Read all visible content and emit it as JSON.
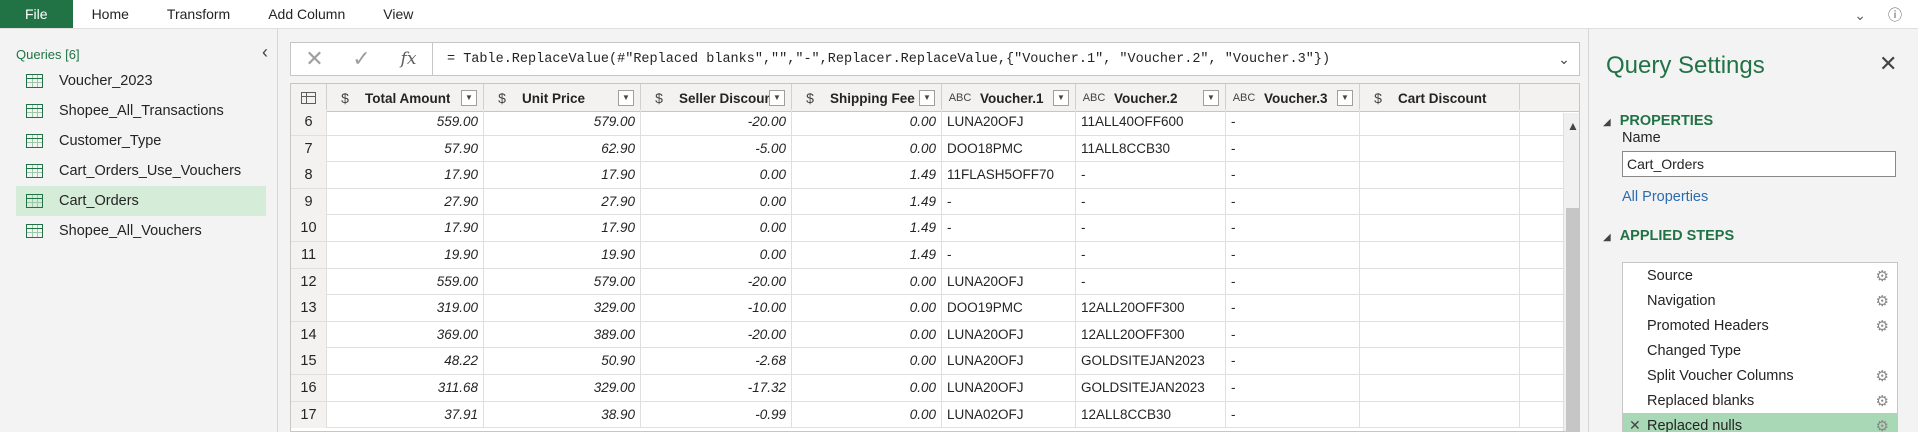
{
  "ribbon": {
    "tabs": [
      "File",
      "Home",
      "Transform",
      "Add Column",
      "View"
    ],
    "right_icons": [
      "chevron-down-icon",
      "help-icon"
    ]
  },
  "queries_pane": {
    "header": "Queries [6]",
    "items": [
      {
        "label": "Voucher_2023",
        "selected": false
      },
      {
        "label": "Shopee_All_Transactions",
        "selected": false
      },
      {
        "label": "Customer_Type",
        "selected": false
      },
      {
        "label": "Cart_Orders_Use_Vouchers",
        "selected": false
      },
      {
        "label": "Cart_Orders",
        "selected": true
      },
      {
        "label": "Shopee_All_Vouchers",
        "selected": false
      }
    ]
  },
  "formula_bar": {
    "cancel_icon": "close-icon",
    "confirm_icon": "check-icon",
    "fx_label": "fx",
    "formula": "= Table.ReplaceValue(#\"Replaced blanks\",\"\",\"-\",Replacer.ReplaceValue,{\"Voucher.1\", \"Voucher.2\", \"Voucher.3\"})"
  },
  "grid": {
    "columns": [
      {
        "name": "Total Amount",
        "type": "$",
        "align": "num"
      },
      {
        "name": "Unit Price",
        "type": "$",
        "align": "num"
      },
      {
        "name": "Seller Discount",
        "type": "$",
        "align": "num"
      },
      {
        "name": "Shipping Fee",
        "type": "$",
        "align": "num"
      },
      {
        "name": "Voucher.1",
        "type": "ABC",
        "align": "txt"
      },
      {
        "name": "Voucher.2",
        "type": "ABC",
        "align": "txt"
      },
      {
        "name": "Voucher.3",
        "type": "ABC",
        "align": "txt"
      },
      {
        "name": "Cart Discount",
        "type": "$",
        "align": "num"
      }
    ],
    "rows": [
      {
        "n": "6",
        "cells": [
          "559.00",
          "579.00",
          "-20.00",
          "0.00",
          "LUNA20OFJ",
          "11ALL40OFF600",
          "-",
          ""
        ]
      },
      {
        "n": "7",
        "cells": [
          "57.90",
          "62.90",
          "-5.00",
          "0.00",
          "DOO18PMC",
          "11ALL8CCB30",
          "-",
          ""
        ]
      },
      {
        "n": "8",
        "cells": [
          "17.90",
          "17.90",
          "0.00",
          "1.49",
          "11FLASH5OFF70",
          "-",
          "-",
          ""
        ]
      },
      {
        "n": "9",
        "cells": [
          "27.90",
          "27.90",
          "0.00",
          "1.49",
          "-",
          "-",
          "-",
          ""
        ]
      },
      {
        "n": "10",
        "cells": [
          "17.90",
          "17.90",
          "0.00",
          "1.49",
          "-",
          "-",
          "-",
          ""
        ]
      },
      {
        "n": "11",
        "cells": [
          "19.90",
          "19.90",
          "0.00",
          "1.49",
          "-",
          "-",
          "-",
          ""
        ]
      },
      {
        "n": "12",
        "cells": [
          "559.00",
          "579.00",
          "-20.00",
          "0.00",
          "LUNA20OFJ",
          "-",
          "-",
          ""
        ]
      },
      {
        "n": "13",
        "cells": [
          "319.00",
          "329.00",
          "-10.00",
          "0.00",
          "DOO19PMC",
          "12ALL20OFF300",
          "-",
          ""
        ]
      },
      {
        "n": "14",
        "cells": [
          "369.00",
          "389.00",
          "-20.00",
          "0.00",
          "LUNA20OFJ",
          "12ALL20OFF300",
          "-",
          ""
        ]
      },
      {
        "n": "15",
        "cells": [
          "48.22",
          "50.90",
          "-2.68",
          "0.00",
          "LUNA20OFJ",
          "GOLDSITEJAN2023",
          "-",
          ""
        ]
      },
      {
        "n": "16",
        "cells": [
          "311.68",
          "329.00",
          "-17.32",
          "0.00",
          "LUNA20OFJ",
          "GOLDSITEJAN2023",
          "-",
          ""
        ]
      },
      {
        "n": "17",
        "cells": [
          "37.91",
          "38.90",
          "-0.99",
          "0.00",
          "LUNA02OFJ",
          "12ALL8CCB30",
          "-",
          ""
        ]
      }
    ]
  },
  "settings_pane": {
    "title": "Query Settings",
    "properties_header": "PROPERTIES",
    "name_label": "Name",
    "name_value": "Cart_Orders",
    "all_properties_link": "All Properties",
    "applied_steps_header": "APPLIED STEPS",
    "steps": [
      {
        "label": "Source",
        "gear": true,
        "selected": false
      },
      {
        "label": "Navigation",
        "gear": true,
        "selected": false
      },
      {
        "label": "Promoted Headers",
        "gear": true,
        "selected": false
      },
      {
        "label": "Changed Type",
        "gear": false,
        "selected": false
      },
      {
        "label": "Split Voucher Columns",
        "gear": true,
        "selected": false
      },
      {
        "label": "Replaced blanks",
        "gear": true,
        "selected": false
      },
      {
        "label": "Replaced nulls",
        "gear": true,
        "selected": true
      }
    ]
  },
  "colors": {
    "accent": "#217346",
    "selected_query": "#d5ecd9",
    "selected_step": "#a8d8b6",
    "link": "#2b6cb0"
  }
}
